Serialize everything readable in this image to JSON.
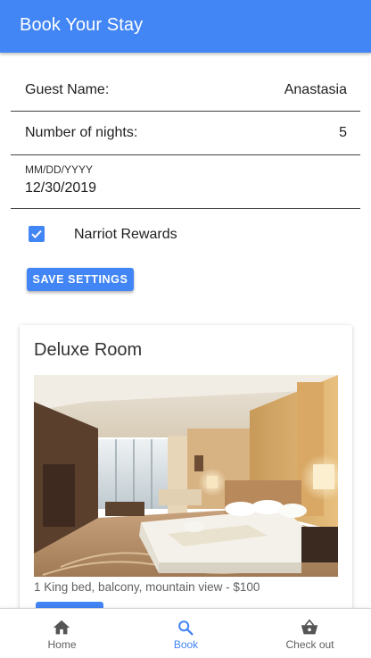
{
  "app_bar": {
    "title": "Book Your Stay"
  },
  "form": {
    "guest_name": {
      "label": "Guest Name:",
      "value": "Anastasia"
    },
    "nights": {
      "label": "Number of nights:",
      "value": "5"
    },
    "date": {
      "placeholder": "MM/DD/YYYY",
      "value": "12/30/2019"
    },
    "rewards": {
      "label": "Narriot Rewards",
      "checked": true
    },
    "save_label": "SAVE SETTINGS"
  },
  "room": {
    "title": "Deluxe Room",
    "description": "1 King bed, balcony, mountain view - $100"
  },
  "bottom_nav": {
    "items": [
      {
        "label": "Home",
        "icon": "home-icon",
        "active": false
      },
      {
        "label": "Book",
        "icon": "search-icon",
        "active": true
      },
      {
        "label": "Check out",
        "icon": "basket-icon",
        "active": false
      }
    ]
  },
  "colors": {
    "primary": "#4285f4",
    "text": "#212121",
    "nav_inactive": "#5f5f5f"
  }
}
